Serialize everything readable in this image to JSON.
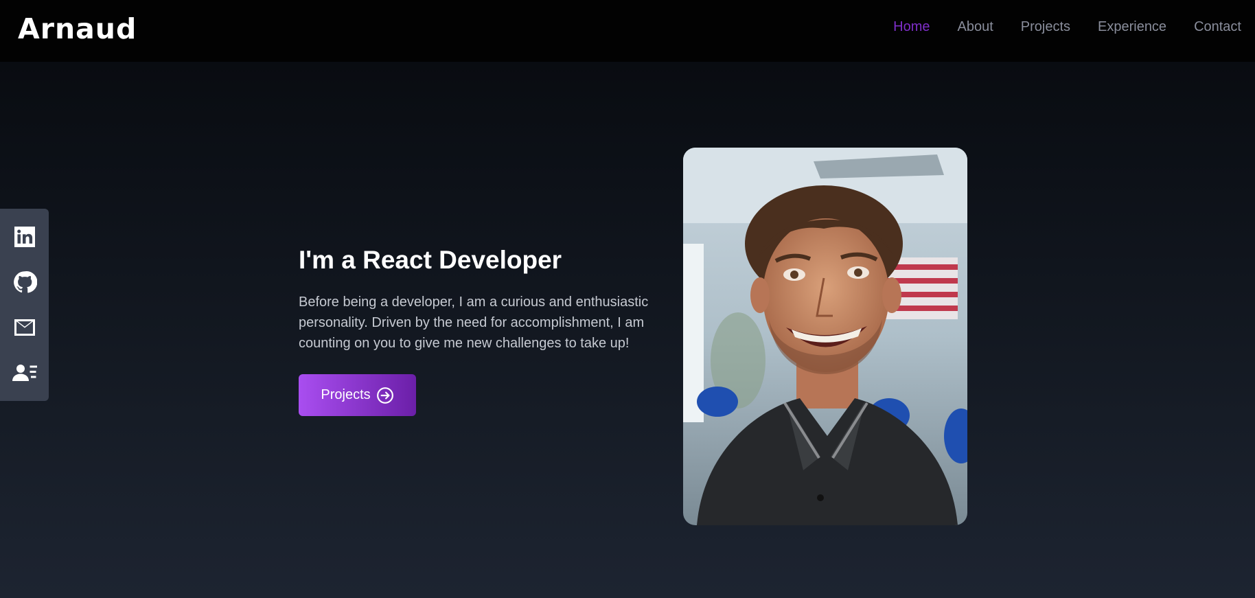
{
  "header": {
    "logo": "Arnaud",
    "nav": [
      {
        "label": "Home",
        "active": true
      },
      {
        "label": "About",
        "active": false
      },
      {
        "label": "Projects",
        "active": false
      },
      {
        "label": "Experience",
        "active": false
      },
      {
        "label": "Contact",
        "active": false
      }
    ]
  },
  "social": {
    "icons": [
      "linkedin-icon",
      "github-icon",
      "mail-icon",
      "contact-card-icon"
    ]
  },
  "hero": {
    "title": "I'm a React Developer",
    "description": "Before being a developer, I am a curious and enthusiastic personality. Driven by the need for accomplishment, I am counting on you to give me new challenges to take up!",
    "cta_label": "Projects",
    "cta_icon": "arrow-right-circle-icon"
  },
  "colors": {
    "accent": "#7e2ec9",
    "button_gradient_start": "#a94ef0",
    "button_gradient_end": "#6b1fa8",
    "header_bg": "#020202",
    "sidebar_bg": "#3a4150"
  }
}
